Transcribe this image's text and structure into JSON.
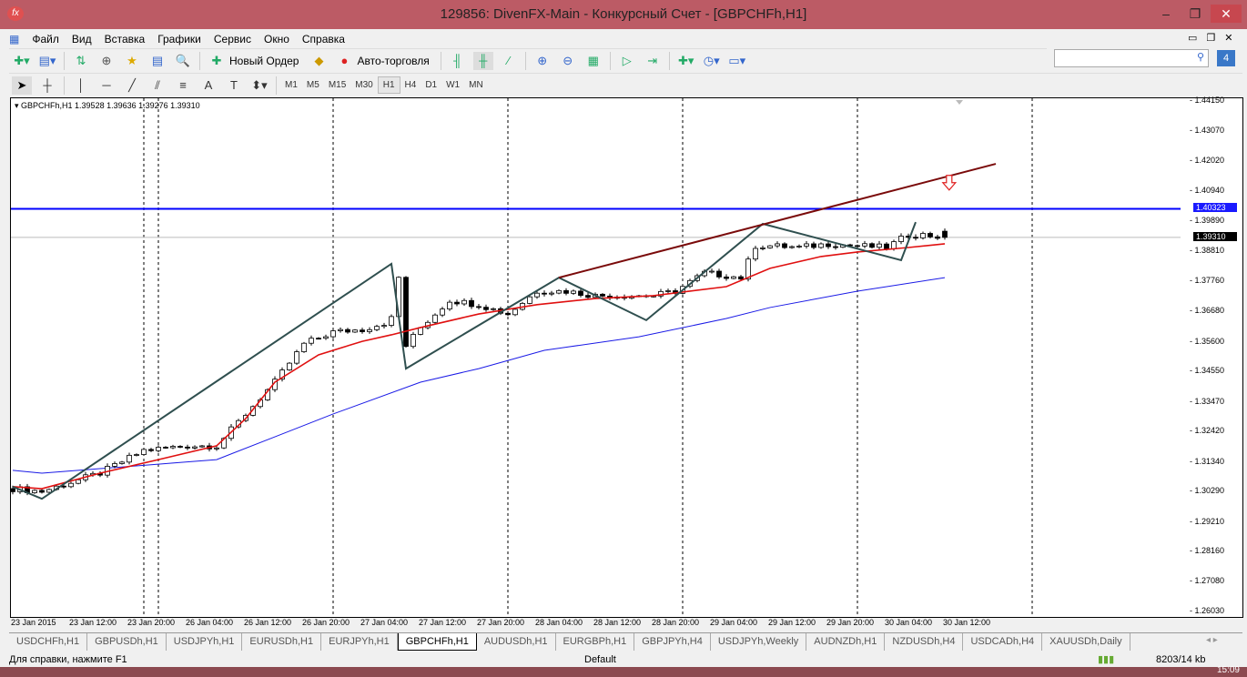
{
  "window": {
    "title": "129856: DivenFX-Main - Конкурсный Счет - [GBPCHFh,H1]",
    "logo": "fx"
  },
  "menu": [
    "Файл",
    "Вид",
    "Вставка",
    "Графики",
    "Сервис",
    "Окно",
    "Справка"
  ],
  "toolbar": {
    "new_order": "Новый Ордер",
    "auto_trading": "Авто-торговля"
  },
  "timeframes": [
    "M1",
    "M5",
    "M15",
    "M30",
    "H1",
    "H4",
    "D1",
    "W1",
    "MN"
  ],
  "active_timeframe": "H1",
  "chart_header": "GBPCHFh,H1  1.39528 1.39636 1.39276 1.39310",
  "chart_data": {
    "type": "candlestick",
    "symbol": "GBPCHFh",
    "timeframe": "H1",
    "ohlc_last": {
      "open": 1.39528,
      "high": 1.39636,
      "low": 1.39276,
      "close": 1.3931
    },
    "y_ticks": [
      "1.44150",
      "1.43070",
      "1.42020",
      "1.40940",
      "1.39890",
      "1.38810",
      "1.37760",
      "1.36680",
      "1.35600",
      "1.34550",
      "1.33470",
      "1.32420",
      "1.31340",
      "1.30290",
      "1.29210",
      "1.28160",
      "1.27080",
      "1.26030"
    ],
    "ylim": [
      1.2603,
      1.4415
    ],
    "x_ticks": [
      "23 Jan 2015",
      "23 Jan 12:00",
      "23 Jan 20:00",
      "26 Jan 04:00",
      "26 Jan 12:00",
      "26 Jan 20:00",
      "27 Jan 04:00",
      "27 Jan 12:00",
      "27 Jan 20:00",
      "28 Jan 04:00",
      "28 Jan 12:00",
      "28 Jan 20:00",
      "29 Jan 04:00",
      "29 Jan 12:00",
      "29 Jan 20:00",
      "30 Jan 04:00",
      "30 Jan 12:00"
    ],
    "bars_per_tick": 8,
    "close_keypoints": [
      [
        0,
        1.3039
      ],
      [
        4,
        1.3029
      ],
      [
        12,
        1.3094
      ],
      [
        18,
        1.3175
      ],
      [
        24,
        1.3191
      ],
      [
        28,
        1.3191
      ],
      [
        32,
        1.3304
      ],
      [
        36,
        1.3417
      ],
      [
        40,
        1.3553
      ],
      [
        44,
        1.3595
      ],
      [
        48,
        1.3604
      ],
      [
        51,
        1.3627
      ],
      [
        52,
        1.3643
      ],
      [
        53,
        1.3788
      ],
      [
        54,
        1.3546
      ],
      [
        56,
        1.3611
      ],
      [
        60,
        1.3708
      ],
      [
        64,
        1.3692
      ],
      [
        68,
        1.3659
      ],
      [
        72,
        1.374
      ],
      [
        76,
        1.374
      ],
      [
        80,
        1.3724
      ],
      [
        86,
        1.3724
      ],
      [
        88,
        1.3724
      ],
      [
        91,
        1.374
      ],
      [
        95,
        1.3805
      ],
      [
        100,
        1.3788
      ],
      [
        102,
        1.3901
      ],
      [
        104,
        1.3901
      ],
      [
        108,
        1.3895
      ],
      [
        112,
        1.3908
      ],
      [
        116,
        1.3901
      ],
      [
        120,
        1.3895
      ],
      [
        123,
        1.394
      ],
      [
        125,
        1.394
      ],
      [
        128,
        1.3931
      ]
    ],
    "ma_fast": [
      [
        0,
        1.3046
      ],
      [
        4,
        1.3039
      ],
      [
        12,
        1.3094
      ],
      [
        20,
        1.3142
      ],
      [
        28,
        1.3191
      ],
      [
        32,
        1.3288
      ],
      [
        36,
        1.3417
      ],
      [
        42,
        1.3514
      ],
      [
        48,
        1.3562
      ],
      [
        52,
        1.3585
      ],
      [
        56,
        1.3611
      ],
      [
        64,
        1.3659
      ],
      [
        72,
        1.3692
      ],
      [
        80,
        1.3714
      ],
      [
        88,
        1.3724
      ],
      [
        98,
        1.3756
      ],
      [
        104,
        1.3821
      ],
      [
        111,
        1.3863
      ],
      [
        116,
        1.3879
      ],
      [
        123,
        1.3895
      ],
      [
        128,
        1.3908
      ]
    ],
    "ma_slow": [
      [
        0,
        1.3104
      ],
      [
        4,
        1.3094
      ],
      [
        12,
        1.311
      ],
      [
        20,
        1.3126
      ],
      [
        28,
        1.3142
      ],
      [
        36,
        1.3223
      ],
      [
        44,
        1.3304
      ],
      [
        56,
        1.3417
      ],
      [
        64,
        1.3465
      ],
      [
        73,
        1.353
      ],
      [
        86,
        1.3578
      ],
      [
        98,
        1.3643
      ],
      [
        104,
        1.3682
      ],
      [
        116,
        1.374
      ],
      [
        128,
        1.3788
      ]
    ],
    "zigzag": [
      [
        0,
        1.3046
      ],
      [
        4,
        1.3003
      ],
      [
        52,
        1.3837
      ],
      [
        54,
        1.3465
      ],
      [
        75,
        1.3788
      ],
      [
        87,
        1.3637
      ],
      [
        103,
        1.3979
      ],
      [
        122,
        1.385
      ],
      [
        124,
        1.3985
      ]
    ],
    "trendline": [
      [
        75,
        1.3788
      ],
      [
        135,
        1.4192
      ]
    ],
    "hline": {
      "price": "1.40323",
      "color": "#0000ff"
    },
    "bid": {
      "price": "1.39310"
    },
    "arrow": {
      "bar": 128.6,
      "price": 1.4125,
      "direction": "down",
      "color": "#e02020"
    },
    "period_separators": [
      18,
      20,
      44,
      68,
      92,
      116,
      140
    ]
  },
  "tabs": [
    {
      "label": "USDCHFh,H1"
    },
    {
      "label": "GBPUSDh,H1"
    },
    {
      "label": "USDJPYh,H1"
    },
    {
      "label": "EURUSDh,H1"
    },
    {
      "label": "EURJPYh,H1"
    },
    {
      "label": "GBPCHFh,H1",
      "active": true
    },
    {
      "label": "AUDUSDh,H1"
    },
    {
      "label": "EURGBPh,H1"
    },
    {
      "label": "GBPJPYh,H4"
    },
    {
      "label": "USDJPYh,Weekly"
    },
    {
      "label": "AUDNZDh,H1"
    },
    {
      "label": "NZDUSDh,H4"
    },
    {
      "label": "USDCADh,H4"
    },
    {
      "label": "XAUUSDh,Daily"
    }
  ],
  "status": {
    "help": "Для справки, нажмите F1",
    "profile": "Default",
    "traffic": "8203/14 kb"
  },
  "taskbar": {
    "clock": "15:09"
  }
}
